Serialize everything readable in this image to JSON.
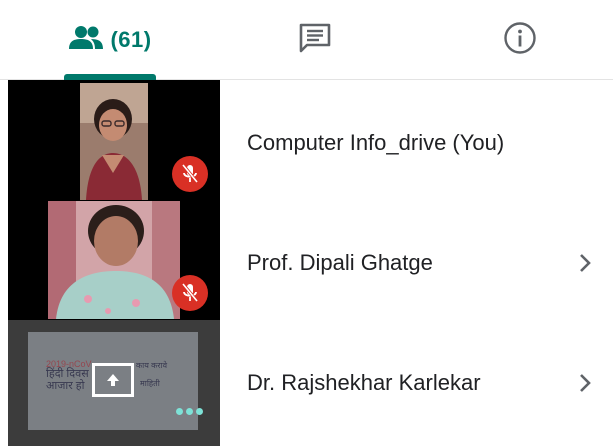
{
  "tabs": {
    "people_count": "(61)",
    "active": "people"
  },
  "colors": {
    "accent": "#00796b",
    "mic_off": "#d93025"
  },
  "tiles": {
    "participant_1": {
      "muted": true
    },
    "participant_2": {
      "muted": true
    },
    "presentation": {
      "preview_lines": [
        "2019-nCoV",
        "हिंदी दिवस",
        "आजार हो",
        "काय करावे",
        "माहिती"
      ]
    }
  },
  "participants": [
    {
      "name": "Computer Info_drive (You)",
      "has_chevron": false
    },
    {
      "name": "Prof. Dipali Ghatge",
      "has_chevron": true
    },
    {
      "name": "Dr. Rajshekhar Karlekar",
      "has_chevron": true
    }
  ]
}
